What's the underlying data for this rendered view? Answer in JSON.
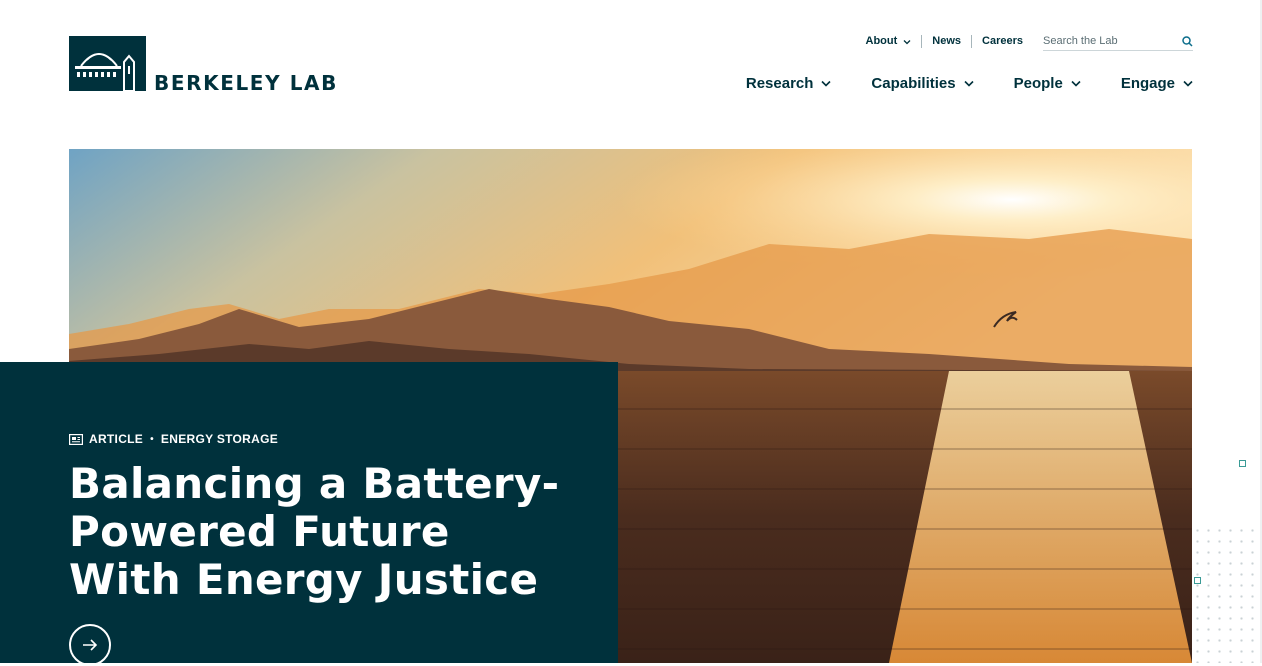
{
  "brand": {
    "name": "BERKELEY LAB"
  },
  "utility_nav": {
    "items": [
      "About",
      "News",
      "Careers"
    ]
  },
  "search": {
    "placeholder": "Search the Lab"
  },
  "main_nav": {
    "items": [
      "Research",
      "Capabilities",
      "People",
      "Engage"
    ]
  },
  "hero": {
    "meta_type": "ARTICLE",
    "meta_separator": "•",
    "meta_topic": "ENERGY STORAGE",
    "headline": "Balancing a Battery-Powered Future With Energy Justice"
  },
  "colors": {
    "brand": "#00313c",
    "accent": "#3a9b96",
    "sun": "#f6a03a"
  },
  "icons": [
    "berkeley-lab-logo",
    "chevron-down-icon",
    "search-icon",
    "newspaper-icon",
    "arrow-right-icon"
  ]
}
